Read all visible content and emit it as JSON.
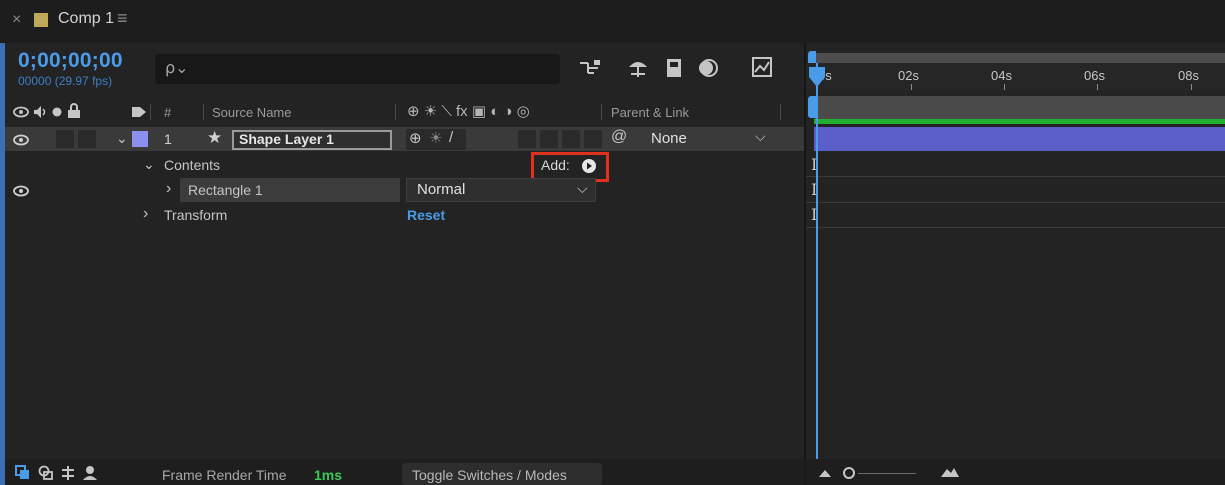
{
  "tab": {
    "close": "×",
    "title": "Comp 1",
    "menu": "≡"
  },
  "header": {
    "timecode": "0;00;00;00",
    "fps": "00000 (29.97 fps)",
    "search_icon": "⍴⌄"
  },
  "columns": {
    "hash": "#",
    "source_name": "Source Name",
    "parent_link": "Parent & Link",
    "switches": "⊕ ☀ ⟍ fx ▣ ◐ ◑ ◎"
  },
  "layer": {
    "number": "1",
    "star": "★",
    "name": "Shape Layer 1",
    "parent": "None",
    "parent_chevron": "⌵",
    "expand": "⌄",
    "pickwhip": "@"
  },
  "contents": {
    "chevron": "⌄",
    "label": "Contents",
    "add_label": "Add:",
    "add_icon": "▶"
  },
  "rectangle": {
    "chevron": "›",
    "label": "Rectangle 1",
    "mode": "Normal",
    "mode_chevron": "⌵"
  },
  "transform": {
    "chevron": "›",
    "label": "Transform",
    "reset": "Reset"
  },
  "bottom": {
    "render_label": "Frame Render Time",
    "render_value": "1ms",
    "toggle_label": "Toggle Switches / Modes"
  },
  "ruler": {
    "labels": [
      "0s",
      "02s",
      "04s",
      "06s",
      "08s"
    ]
  },
  "colors": {
    "accent": "#4a9be8",
    "label_swatch": "#8c8ef0",
    "layer_bar": "#5a5ec8",
    "highlight": "#e2301f",
    "green_bar": "#22b033"
  }
}
